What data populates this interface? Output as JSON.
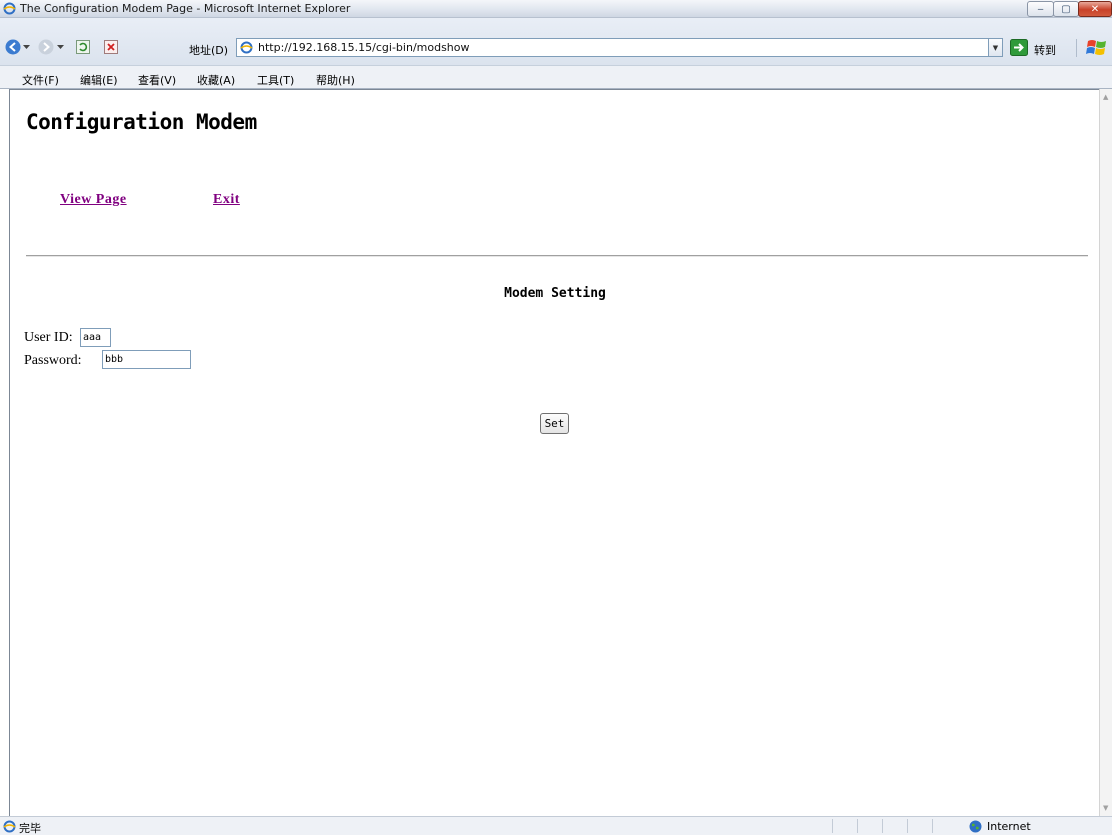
{
  "window": {
    "title": "The Configuration Modem Page - Microsoft Internet Explorer",
    "min_glyph": "‒",
    "max_glyph": "▢",
    "close_glyph": "✕"
  },
  "addressbar": {
    "label": "地址(D)",
    "url": "http://192.168.15.15/cgi-bin/modshow",
    "go_label": "转到"
  },
  "menu": {
    "items": [
      "文件(F)",
      "编辑(E)",
      "查看(V)",
      "收藏(A)",
      "工具(T)",
      "帮助(H)"
    ]
  },
  "page": {
    "title": "Configuration Modem",
    "links": {
      "view_page": "View Page",
      "exit": "Exit"
    },
    "section_heading": "Modem Setting",
    "user_id_label": "User ID:",
    "user_id_value": "aaa",
    "password_label": "Password:",
    "password_value": "bbb",
    "set_button": "Set"
  },
  "statusbar": {
    "text": "完毕",
    "zone": "Internet"
  },
  "colors": {
    "visited_link": "#800080",
    "close_button": "#c8422a"
  }
}
